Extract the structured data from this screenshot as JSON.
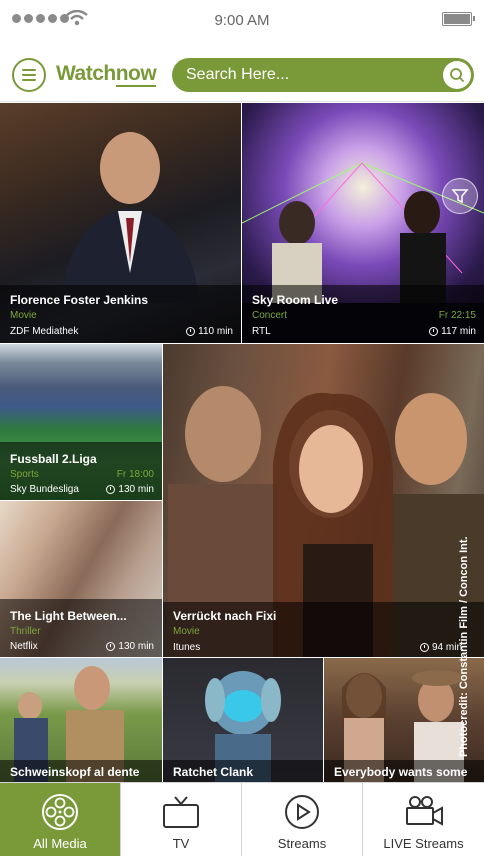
{
  "status_bar": {
    "time": "9:00 AM"
  },
  "header": {
    "logo_watch": "Watch",
    "logo_now": "now",
    "search_placeholder": "Search Here..."
  },
  "tiles": [
    {
      "title": "Florence Foster Jenkins",
      "genre": "Movie",
      "time": "",
      "channel": "ZDF Mediathek",
      "duration": "110 min"
    },
    {
      "title": "Sky Room Live",
      "genre": "Concert",
      "time": "Fr 22:15",
      "channel": "RTL",
      "duration": "117 min"
    },
    {
      "title": "Fussball 2.Liga",
      "genre": "Sports",
      "time": "Fr 18:00",
      "channel": "Sky Bundesliga",
      "duration": "130 min"
    },
    {
      "title": "Verrückt nach Fixi",
      "genre": "Movie",
      "time": "",
      "channel": "Itunes",
      "duration": "94 min"
    },
    {
      "title": "The Light Between...",
      "genre": "Thriller",
      "time": "",
      "channel": "Netflix",
      "duration": "130 min"
    },
    {
      "title": "Schweinskopf al dente",
      "genre": "",
      "time": "",
      "channel": "",
      "duration": ""
    },
    {
      "title": "Ratchet Clank",
      "genre": "",
      "time": "",
      "channel": "",
      "duration": ""
    },
    {
      "title": "Everybody wants some",
      "genre": "",
      "time": "",
      "channel": "",
      "duration": ""
    }
  ],
  "photo_credit": "Photocredit: Constantin Film / Concon Int.",
  "tabs": [
    {
      "label": "All Media",
      "icon": "film-reel-icon"
    },
    {
      "label": "TV",
      "icon": "tv-icon"
    },
    {
      "label": "Streams",
      "icon": "play-circle-icon"
    },
    {
      "label": "LIVE Streams",
      "icon": "video-camera-icon"
    }
  ],
  "colors": {
    "accent": "#7a9a3a",
    "genre_green": "#7da83d"
  }
}
